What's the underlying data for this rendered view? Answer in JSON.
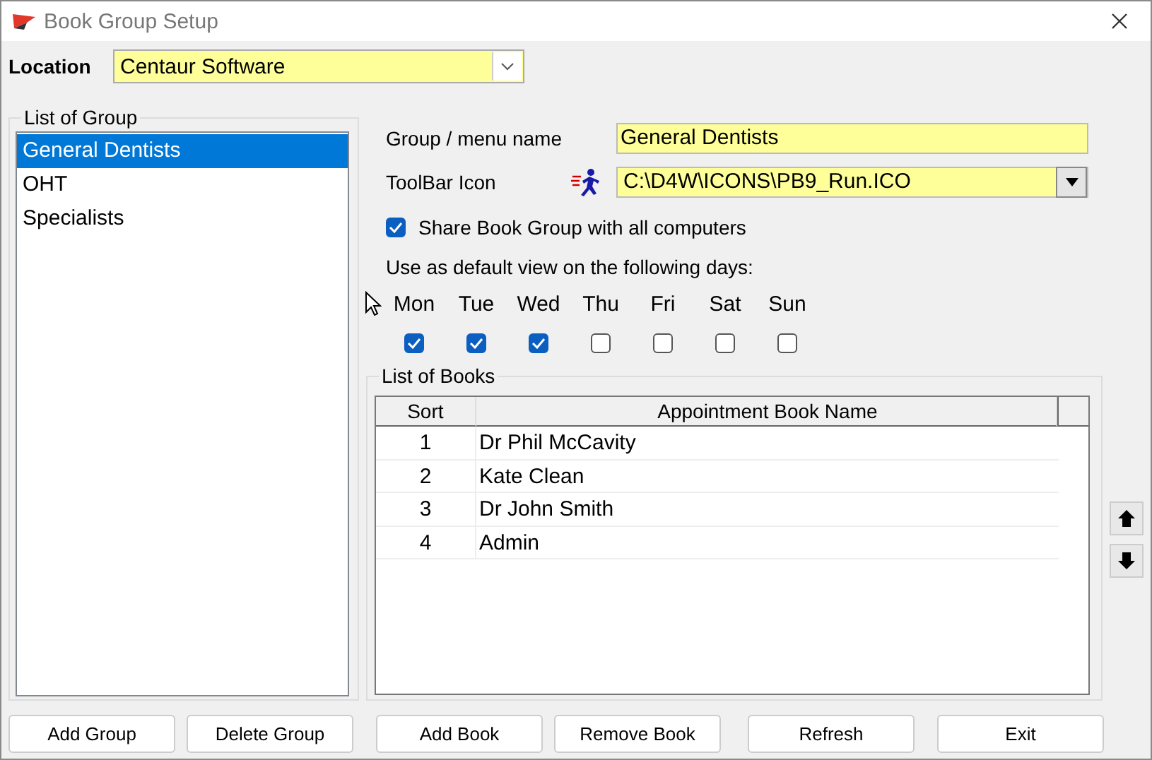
{
  "window": {
    "title": "Book Group Setup"
  },
  "location": {
    "label": "Location",
    "value": "Centaur Software"
  },
  "group_list": {
    "title": "List of Group",
    "items": [
      {
        "label": "General Dentists",
        "selected": true
      },
      {
        "label": "OHT",
        "selected": false
      },
      {
        "label": "Specialists",
        "selected": false
      }
    ]
  },
  "group_name": {
    "label": "Group / menu name",
    "value": "General Dentists"
  },
  "toolbar_icon": {
    "label": "ToolBar Icon",
    "value": "C:\\D4W\\ICONS\\PB9_Run.ICO"
  },
  "share": {
    "label": "Share Book Group with all computers",
    "checked": true
  },
  "default_days": {
    "label": "Use as default view on the following days:",
    "days": [
      {
        "label": "Mon",
        "checked": true
      },
      {
        "label": "Tue",
        "checked": true
      },
      {
        "label": "Wed",
        "checked": true
      },
      {
        "label": "Thu",
        "checked": false
      },
      {
        "label": "Fri",
        "checked": false
      },
      {
        "label": "Sat",
        "checked": false
      },
      {
        "label": "Sun",
        "checked": false
      }
    ]
  },
  "books": {
    "title": "List of Books",
    "columns": [
      "Sort",
      "Appointment Book Name"
    ],
    "rows": [
      [
        "1",
        "Dr Phil McCavity"
      ],
      [
        "2",
        "Kate Clean"
      ],
      [
        "3",
        "Dr John Smith"
      ],
      [
        "4",
        "Admin"
      ]
    ]
  },
  "buttons": [
    "Add Group",
    "Delete Group",
    "Add Book",
    "Remove Book",
    "Refresh",
    "Exit"
  ]
}
